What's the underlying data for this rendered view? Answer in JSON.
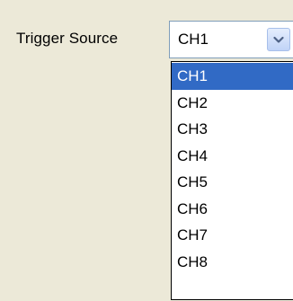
{
  "trigger": {
    "label": "Trigger Source",
    "selected_value": "CH1",
    "dropdown_icon": "chevron-down-icon",
    "options": [
      "CH1",
      "CH2",
      "CH3",
      "CH4",
      "CH5",
      "CH6",
      "CH7",
      "CH8"
    ],
    "highlighted_option": "CH1"
  },
  "colors": {
    "window_background": "#ECE9D8",
    "highlight": "#316AC5",
    "combo_border": "#7F9DB9"
  }
}
